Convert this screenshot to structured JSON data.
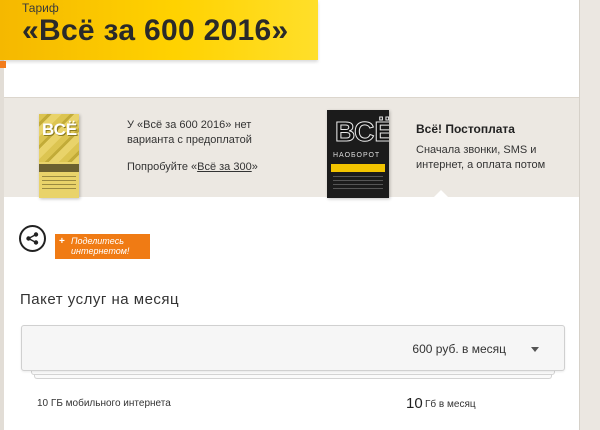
{
  "header": {
    "label": "Тариф",
    "title": "«Всё за 600 2016»"
  },
  "tariffs": {
    "current": {
      "pack_word": "ВСЁ!",
      "text_line": "У «Всё за 600 2016» нет варианта с предоплатой",
      "suggest_prefix": "Попробуйте «",
      "suggest_link": "Всё за 300",
      "suggest_suffix": "»"
    },
    "postpaid": {
      "pack_word": "ВСЁ",
      "pack_sub": "НАОБОРОТ",
      "title": "Всё! Постоплата",
      "description": "Сначала звонки, SMS и интернет, а оплата потом"
    }
  },
  "share": {
    "icon": "share-icon",
    "badge_label": "Поделитесь интернетом!",
    "badge_icon": "+"
  },
  "package": {
    "title": "Пакет услуг на месяц",
    "selected_price": "600 руб. в месяц"
  },
  "rows": [
    {
      "label": "10 ГБ мобильного интернета",
      "value": "10",
      "unit": "Гб в месяц"
    }
  ],
  "colors": {
    "banner_yellow": "#ffd200",
    "accent_orange": "#f07b14",
    "panel_beige": "#ece8e2"
  }
}
